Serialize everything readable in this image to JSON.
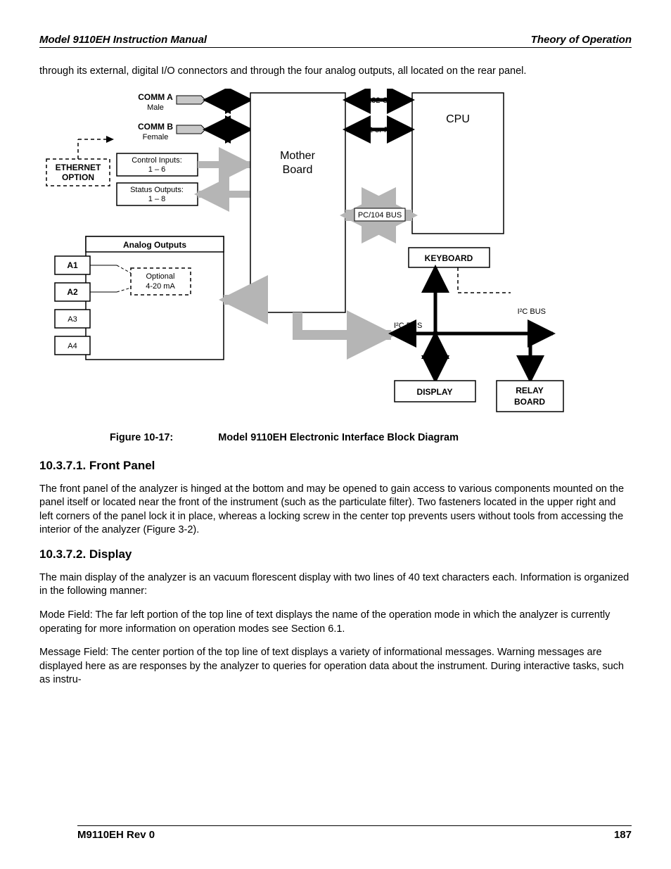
{
  "header": {
    "left": "Model 9110EH Instruction Manual",
    "right": "Theory of Operation"
  },
  "intro_paragraph": "through its external, digital I/O connectors and through the four analog outputs, all located on the rear panel.",
  "diagram": {
    "comm_a": "COMM A",
    "comm_a_sub": "Male",
    "comm_b": "COMM B",
    "comm_b_sub": "Female",
    "ethernet": "ETHERNET\nOPTION",
    "control_inputs": "Control Inputs:\n1 – 6",
    "status_outputs": "Status Outputs:\n1 – 8",
    "rs232_only": "RS-232 ONLY",
    "rs232_or_485": "RS-232 or RS-485",
    "mother_board": "Mother\nBoard",
    "pc104": "PC/104 BUS",
    "cpu": "CPU",
    "analog_outputs": "Analog Outputs",
    "a1": "A1",
    "a2": "A2",
    "a3": "A3",
    "a4": "A4",
    "optional_420": "Optional\n4-20 mA",
    "keyboard": "KEYBOARD",
    "display": "DISPLAY",
    "relay_board": "RELAY\nBOARD",
    "i2c_bus_1": "I²C BUS",
    "i2c_bus_2": "I²C BUS"
  },
  "caption": {
    "label": "Figure 10-17:",
    "text": "Model 9110EH Electronic Interface Block Diagram"
  },
  "sections": [
    {
      "heading": "10.3.7.1. Front Panel",
      "paragraphs": [
        "The front panel of the analyzer is hinged at the bottom and may be opened to gain access to various components mounted on the panel itself or located near the front of the instrument (such as the particulate filter). Two fasteners located in the upper right and left corners of the panel lock it in place, whereas a locking screw in the center top prevents users without tools from accessing the interior of the analyzer (Figure 3-2)."
      ]
    },
    {
      "heading": "10.3.7.2. Display",
      "paragraphs": [
        "The main display of the analyzer is an vacuum florescent display with two lines of 40 text characters each. Information is organized in the following manner:",
        "Mode Field: The far left portion of the top line of text displays the name of the operation mode in which the analyzer is currently operating for more information on operation modes see Section 6.1.",
        "Message Field: The center portion of the top line of text displays a variety of informational messages. Warning messages are displayed here as are responses by the analyzer to queries for operation data about the instrument. During interactive tasks, such as instru-"
      ]
    }
  ],
  "footer": {
    "left": "M9110EH Rev 0",
    "right": "187"
  }
}
